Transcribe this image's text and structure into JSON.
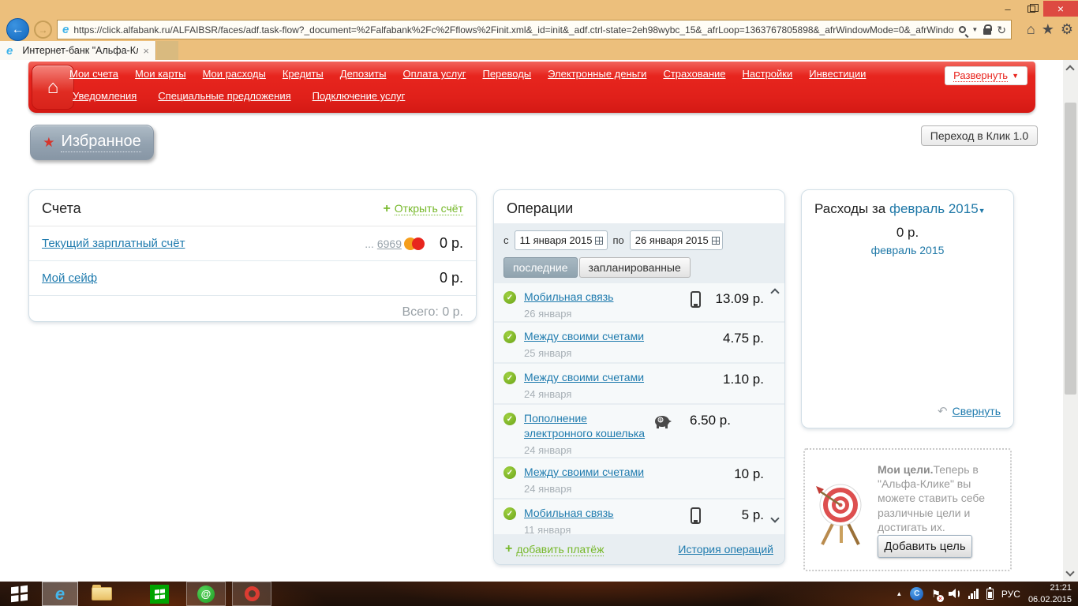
{
  "window": {
    "minimize": "–",
    "close": "×"
  },
  "browser": {
    "url": "https://click.alfabank.ru/ALFAIBSR/faces/adf.task-flow?_document=%2Falfabank%2Fc%2Fflows%2Finit.xml&_id=init&_adf.ctrl-state=2eh98wybc_15&_afrLoop=1363767805898&_afrWindowMode=0&_afrWindov",
    "tab_title": "Интернет-банк \"Альфа-Кл...",
    "tab_close": "×",
    "back_arrow": "←",
    "forward_arrow": "→",
    "refresh": "↻",
    "dropdown": "▼",
    "home": "⌂",
    "favorites_star": "★",
    "settings_gear": "⚙"
  },
  "nav": {
    "row1": [
      "Мои счета",
      "Мои карты",
      "Мои расходы",
      "Кредиты",
      "Депозиты",
      "Оплата услуг",
      "Переводы",
      "Электронные деньги",
      "Страхование",
      "Настройки",
      "Инвестиции"
    ],
    "row2": [
      "Уведомления",
      "Специальные предложения",
      "Подключение услуг"
    ],
    "expand_label": "Развернуть",
    "expand_arrow": "▼",
    "home_icon": "⌂"
  },
  "page": {
    "favorites_label": "Избранное",
    "favorites_star": "★",
    "switch_button": "Переход в Клик 1.0"
  },
  "accounts": {
    "title": "Счета",
    "open_plus": "+",
    "open_label": "Открыть счёт",
    "rows": [
      {
        "name": "Текущий зарплатный счёт",
        "mask_prefix": "...",
        "mask_digits": "6969",
        "amount": "0 р."
      },
      {
        "name": "Мой сейф",
        "amount": "0 р."
      }
    ],
    "total_label": "Всего:",
    "total_value": "0 р."
  },
  "operations": {
    "title": "Операции",
    "from_label": "с",
    "from_value": "11 января 2015",
    "to_label": "по",
    "to_value": "26 января 2015",
    "tab_active": "последние",
    "tab_inactive": "запланированные",
    "items": [
      {
        "title": "Мобильная связь",
        "date": "26 января",
        "amount": "13.09 р."
      },
      {
        "title": "Между своими счетами",
        "date": "25 января",
        "amount": "4.75 р."
      },
      {
        "title": "Между своими счетами",
        "date": "24 января",
        "amount": "1.10 р."
      },
      {
        "title": "Пополнение электронного кошелька",
        "date": "24 января",
        "amount": "6.50 р."
      },
      {
        "title": "Между своими счетами",
        "date": "24 января",
        "amount": "10 р."
      },
      {
        "title": "Мобильная связь",
        "date": "11 января",
        "amount": "5 р."
      }
    ],
    "add_plus": "+",
    "add_payment_label": "добавить платёж",
    "history_label": "История операций",
    "check_mark": "✓"
  },
  "expenses": {
    "title_prefix": "Расходы за",
    "period": "февраль 2015",
    "period_arrow": "▼",
    "amount": "0 р.",
    "subtitle": "февраль 2015",
    "collapse_icon": "↶",
    "collapse_label": "Свернуть"
  },
  "goals": {
    "lead": "Мои цели.",
    "text": "Теперь в \"Альфа-Клике\" вы можете ставить себе различные цели и достигать их.",
    "button": "Добавить цель"
  },
  "taskbar": {
    "mail_at": "@",
    "tray_up": "▲",
    "comodo_letter": "C",
    "flag": "⚑",
    "flag_x": "×",
    "lang": "РУС",
    "time": "21:21",
    "date": "06.02.2015"
  }
}
